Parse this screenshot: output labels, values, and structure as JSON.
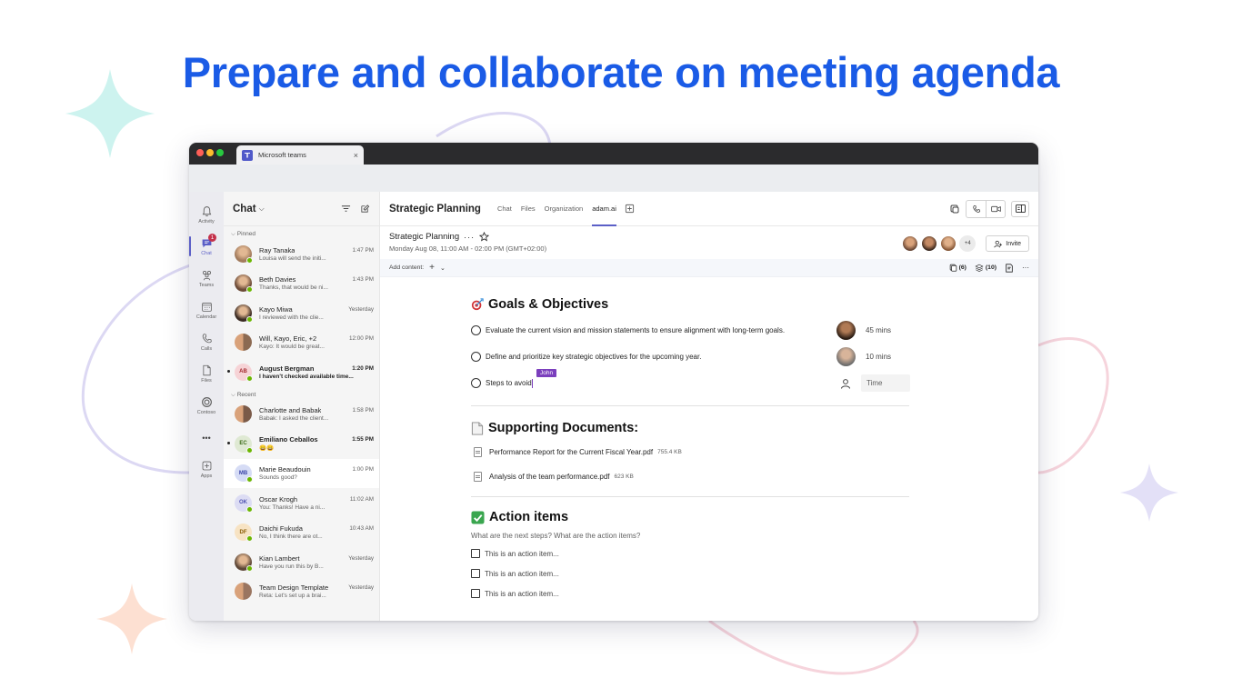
{
  "headline": "Prepare and collaborate on meeting agenda",
  "colors": {
    "headline": "#1a5be6",
    "teams_accent": "#5b5fc7",
    "presence": "#6bb700",
    "cursor_tag": "#7b3fbd"
  },
  "browser": {
    "tab_title": "Microsoft teams",
    "tab_close": "×"
  },
  "rail": {
    "items": [
      {
        "label": "Activity",
        "icon": "bell-icon"
      },
      {
        "label": "Chat",
        "icon": "chat-icon",
        "badge": "1"
      },
      {
        "label": "Teams",
        "icon": "teams-icon"
      },
      {
        "label": "Calendar",
        "icon": "calendar-icon"
      },
      {
        "label": "Calls",
        "icon": "phone-icon"
      },
      {
        "label": "Files",
        "icon": "file-icon"
      },
      {
        "label": "Contoso",
        "icon": "contoso-icon"
      },
      {
        "label": "•••",
        "icon": "more-icon"
      },
      {
        "label": "Apps",
        "icon": "apps-icon"
      }
    ]
  },
  "chatlist": {
    "title": "Chat",
    "chevron": "⌵",
    "pinned_label": "Pinned",
    "recent_label": "Recent",
    "pinned": [
      {
        "name": "Ray Tanaka",
        "time": "1:47 PM",
        "preview": "Louisa will send the initi...",
        "bold": false,
        "avatar": "photo",
        "color": "#a27b5c"
      },
      {
        "name": "Beth Davies",
        "time": "1:43 PM",
        "preview": "Thanks, that would be ni...",
        "bold": false,
        "avatar": "photo",
        "color": "#6b4a36"
      },
      {
        "name": "Kayo Miwa",
        "time": "Yesterday",
        "preview": "I reviewed with the clie...",
        "bold": false,
        "avatar": "photo",
        "color": "#3a2a22"
      },
      {
        "name": "Will, Kayo, Eric, +2",
        "time": "12:00 PM",
        "preview": "Kayo: It would be great...",
        "bold": false,
        "avatar": "group",
        "color": "#8c6a52"
      },
      {
        "name": "August Bergman",
        "time": "1:20 PM",
        "preview": "I haven't checked available time...",
        "bold": true,
        "avatar": "AB",
        "color": "#f6d3d6",
        "text_color": "#a4262c"
      }
    ],
    "recent": [
      {
        "name": "Charlotte and Babak",
        "time": "1:58 PM",
        "preview": "Babak: I asked the client...",
        "bold": false,
        "avatar": "group",
        "color": "#7a5a48"
      },
      {
        "name": "Emiliano Ceballos",
        "time": "1:55 PM",
        "preview": "😄😄",
        "bold": true,
        "avatar": "EC",
        "color": "#dfe9d3",
        "text_color": "#3b6b16"
      },
      {
        "name": "Marie Beaudouin",
        "time": "1:00 PM",
        "preview": "Sounds good?",
        "bold": false,
        "avatar": "MB",
        "color": "#d6dcf5",
        "text_color": "#3a43a8",
        "selected": true
      },
      {
        "name": "Oscar Krogh",
        "time": "11:02 AM",
        "preview": "You: Thanks! Have a ni...",
        "bold": false,
        "avatar": "OK",
        "color": "#dcdcf3",
        "text_color": "#4f52b2"
      },
      {
        "name": "Daichi Fukuda",
        "time": "10:43 AM",
        "preview": "No, I think there are ot...",
        "bold": false,
        "avatar": "DF",
        "color": "#f7e3c3",
        "text_color": "#8a5a00"
      },
      {
        "name": "Kian Lambert",
        "time": "Yesterday",
        "preview": "Have you run this by B...",
        "bold": false,
        "avatar": "photo",
        "color": "#5d4636"
      },
      {
        "name": "Team Design Template",
        "time": "Yesterday",
        "preview": "Reta: Let's set up a brai...",
        "bold": false,
        "avatar": "group",
        "color": "#9a7560"
      }
    ]
  },
  "main": {
    "title": "Strategic Planning",
    "tabs": [
      "Chat",
      "Files",
      "Organization",
      "adam.ai"
    ],
    "active_tab": "adam.ai",
    "meeting_title": "Strategic Planning",
    "meeting_more": "···",
    "meeting_date": "Monday Aug 08, 11:00 AM - 02:00 PM (GMT+02:00)",
    "attendees_more": "+4",
    "invite_label": "Invite",
    "toolbar": {
      "add_content": "Add content:",
      "plus": "+",
      "chevron": "⌄",
      "notes_count": "(6)",
      "layers_count": "(10)",
      "more": "···"
    }
  },
  "doc": {
    "goals": {
      "heading": "Goals & Objectives",
      "items": [
        {
          "text": "Evaluate the current vision and mission statements to ensure alignment with long-term goals.",
          "duration": "45 mins"
        },
        {
          "text": "Define and prioritize key strategic objectives for the upcoming year.",
          "duration": "10 mins"
        },
        {
          "text": "Steps to avoid",
          "time_placeholder": "Time",
          "cursor_user": "John"
        }
      ]
    },
    "documents": {
      "heading": "Supporting Documents:",
      "files": [
        {
          "name": "Performance Report for the Current Fiscal Year.pdf",
          "size": "755.4 KB"
        },
        {
          "name": "Analysis of the team performance.pdf",
          "size": "623 KB"
        }
      ]
    },
    "actions": {
      "heading": "Action items",
      "question": "What are the next steps? What are the action items?",
      "items": [
        "This is an action item...",
        "This is an action item...",
        "This is an action item..."
      ]
    }
  }
}
